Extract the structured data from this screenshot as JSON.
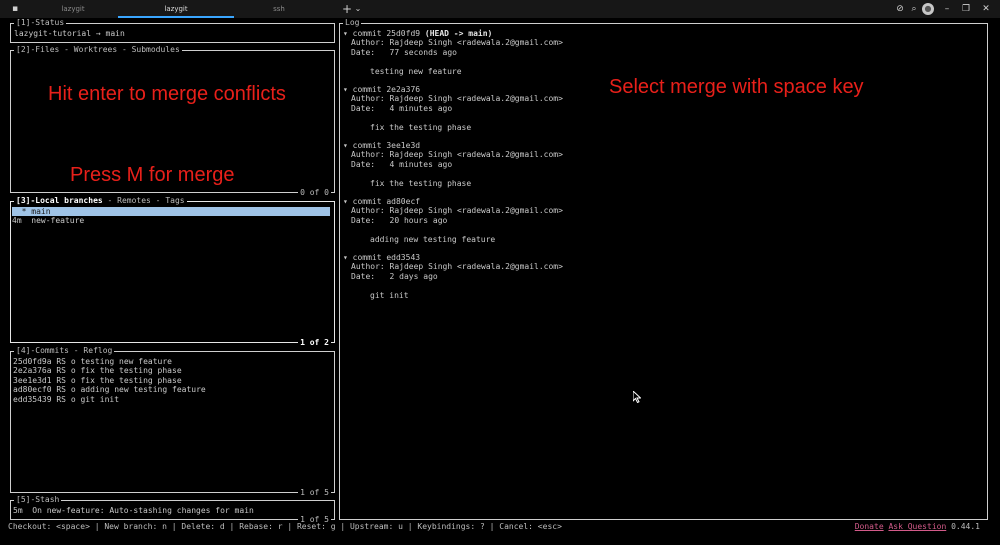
{
  "titlebar": {
    "tabs": [
      "lazygit",
      "lazygit",
      "ssh"
    ],
    "active_tab": 1,
    "new_tab": "+",
    "new_tab_menu": "⌄",
    "icons": [
      "terminal-icon",
      "no-eye-icon",
      "search-icon",
      "avatar-icon",
      "minimize-icon",
      "restore-icon",
      "close-icon"
    ]
  },
  "status_panel": {
    "title": "[1]-Status",
    "line": "lazygit-tutorial → main"
  },
  "files_panel": {
    "title": "[2]-Files - Worktrees - Submodules",
    "footer": "0 of 0"
  },
  "branches_panel": {
    "title_active": "[3]-Local branches",
    "title_rest": " - Remotes - Tags",
    "footer": "1 of 2",
    "items": [
      {
        "prefix": "  * ",
        "name": "main"
      },
      {
        "prefix": "4m  ",
        "name": "new-feature"
      }
    ]
  },
  "commits_panel": {
    "title": "[4]-Commits - Reflog",
    "footer": "1 of 5",
    "items": [
      {
        "hash": "25d0fd9a",
        "author": "RS",
        "marker": "o",
        "msg": "testing new feature"
      },
      {
        "hash": "2e2a376a",
        "author": "RS",
        "marker": "o",
        "msg": "fix the testing phase"
      },
      {
        "hash": "3ee1e3d1",
        "author": "RS",
        "marker": "o",
        "msg": "fix the testing phase"
      },
      {
        "hash": "ad80ecf0",
        "author": "RS",
        "marker": "o",
        "msg": "adding new testing feature"
      },
      {
        "hash": "edd35439",
        "author": "RS",
        "marker": "o",
        "msg": "git init"
      }
    ]
  },
  "stash_panel": {
    "title": "[5]-Stash",
    "footer": "1 of 5",
    "line": "5m  On new-feature: Auto-stashing changes for main"
  },
  "log_panel": {
    "title": "Log",
    "commits": [
      {
        "hash": "25d0fd9",
        "refs": "(HEAD -> main)",
        "author": "Author: Rajdeep Singh <radewala.2@gmail.com>",
        "date": "Date:   77 seconds ago",
        "msg": "testing new feature"
      },
      {
        "hash": "2e2a376",
        "refs": "",
        "author": "Author: Rajdeep Singh <radewala.2@gmail.com>",
        "date": "Date:   4 minutes ago",
        "msg": "fix the testing phase"
      },
      {
        "hash": "3ee1e3d",
        "refs": "",
        "author": "Author: Rajdeep Singh <radewala.2@gmail.com>",
        "date": "Date:   4 minutes ago",
        "msg": "fix the testing phase"
      },
      {
        "hash": "ad80ecf",
        "refs": "",
        "author": "Author: Rajdeep Singh <radewala.2@gmail.com>",
        "date": "Date:   20 hours ago",
        "msg": "adding new testing feature"
      },
      {
        "hash": "edd3543",
        "refs": "",
        "author": "Author: Rajdeep Singh <radewala.2@gmail.com>",
        "date": "Date:   2 days ago",
        "msg": "git init"
      }
    ]
  },
  "overlays": {
    "enter": "Hit enter to merge conflicts",
    "press_m": "Press M for merge",
    "select": "Select merge with space key"
  },
  "statusbar": {
    "keys": "Checkout: <space> | New branch: n | Delete: d | Rebase: r | Reset: g | Upstream: u | Keybindings: ? | Cancel: <esc>",
    "donate": "Donate",
    "ask": "Ask Question",
    "version": "0.44.1"
  },
  "colors": {
    "overlay_red": "#e8201a",
    "selection": "#9fc3e6",
    "tab_accent": "#3aa6ff",
    "link": "#d35b8a"
  }
}
